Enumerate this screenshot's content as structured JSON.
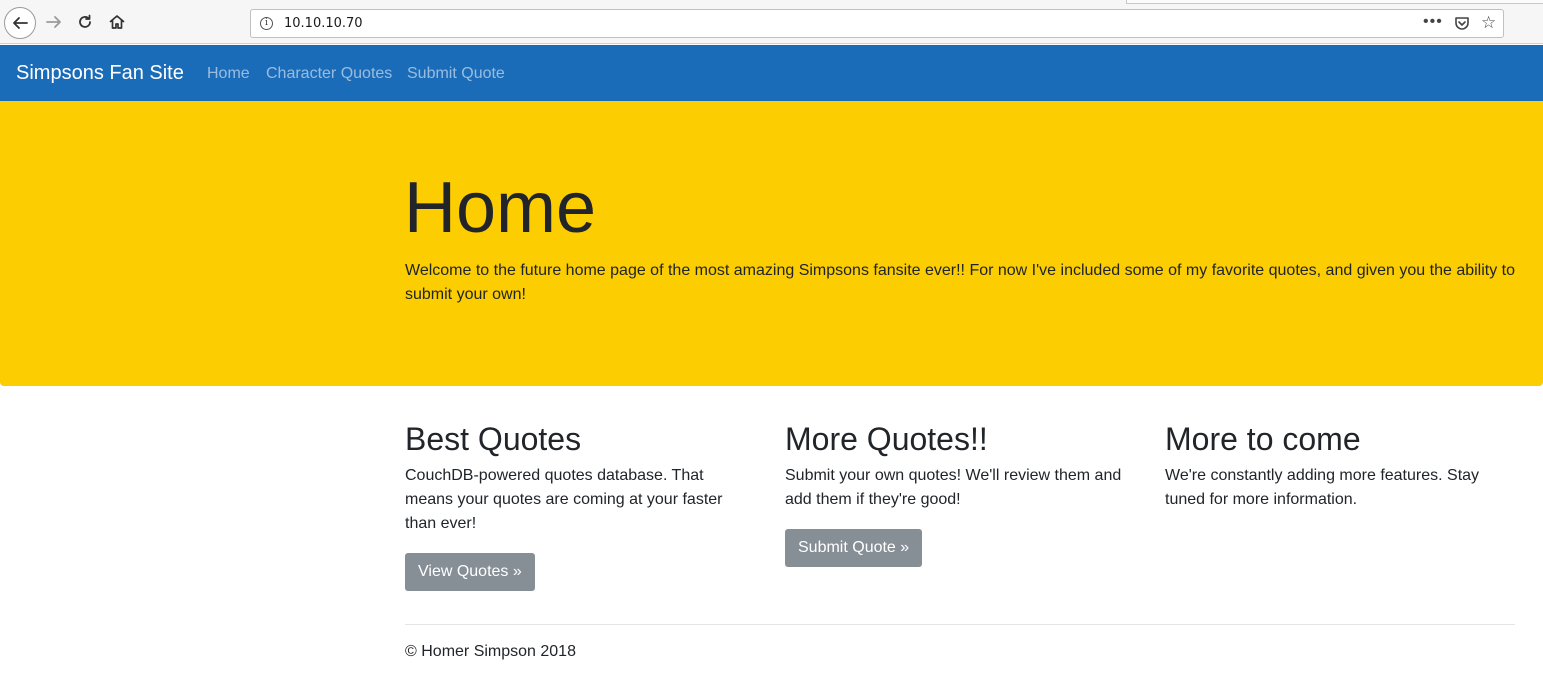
{
  "browser": {
    "url": "10.10.10.70",
    "info_icon": "i",
    "more_label": "•••",
    "star_icon": "☆"
  },
  "navbar": {
    "brand": "Simpsons Fan Site",
    "links": [
      "Home",
      "Character Quotes",
      "Submit Quote"
    ],
    "color": "#1b6cb8"
  },
  "jumbotron": {
    "title": "Home",
    "lead": "Welcome to the future home page of the most amazing Simpsons fansite ever!! For now I've included some of my favorite quotes, and given you the ability to submit your own!",
    "color": "#fccd00"
  },
  "columns": [
    {
      "heading": "Best Quotes",
      "text": "CouchDB-powered quotes database. That means your quotes are coming at your faster than ever!",
      "button": "View Quotes »"
    },
    {
      "heading": "More Quotes!!",
      "text": "Submit your own quotes! We'll review them and add them if they're good!",
      "button": "Submit Quote »"
    },
    {
      "heading": "More to come",
      "text": "We're constantly adding more features. Stay tuned for more information."
    }
  ],
  "footer": {
    "text": "© Homer Simpson 2018"
  }
}
